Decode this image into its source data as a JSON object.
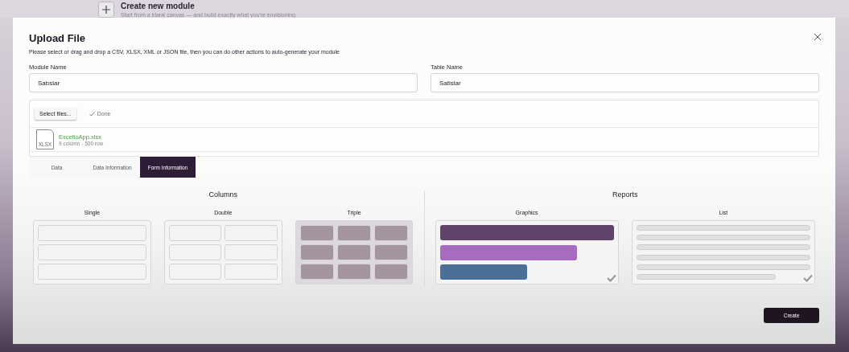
{
  "background_card": {
    "title": "Create new module",
    "subtitle": "Start from a blank canvas — and build exactly what you're envisioning."
  },
  "dialog": {
    "title": "Upload File",
    "description": "Please select or drag and drop a CSV, XLSX, XML or JSON file, then you can do other actions to auto-generate your module"
  },
  "fields": [
    {
      "label": "Module Name",
      "value": "Satıslar"
    },
    {
      "label": "Table Name",
      "value": "Satislar"
    }
  ],
  "upload": {
    "button": "Select files...",
    "status": "Done",
    "file": {
      "name": "ExceltoApp.xlsx",
      "type": "XLSX",
      "meta": "9 column - 500 row"
    }
  },
  "tabs": [
    {
      "label": "Data",
      "selected": false
    },
    {
      "label": "Data Information",
      "selected": false
    },
    {
      "label": "Form Information",
      "selected": true
    }
  ],
  "columns": {
    "title": "Columns",
    "options": [
      {
        "label": "Single",
        "kind": "single",
        "selected": false
      },
      {
        "label": "Double",
        "kind": "double",
        "selected": false
      },
      {
        "label": "Triple",
        "kind": "triple",
        "selected": true
      }
    ]
  },
  "reports": {
    "title": "Reports",
    "options": [
      {
        "label": "Graphics",
        "kind": "graphics",
        "checked": true
      },
      {
        "label": "List",
        "kind": "list",
        "checked": true
      }
    ]
  },
  "create_button": "Create"
}
